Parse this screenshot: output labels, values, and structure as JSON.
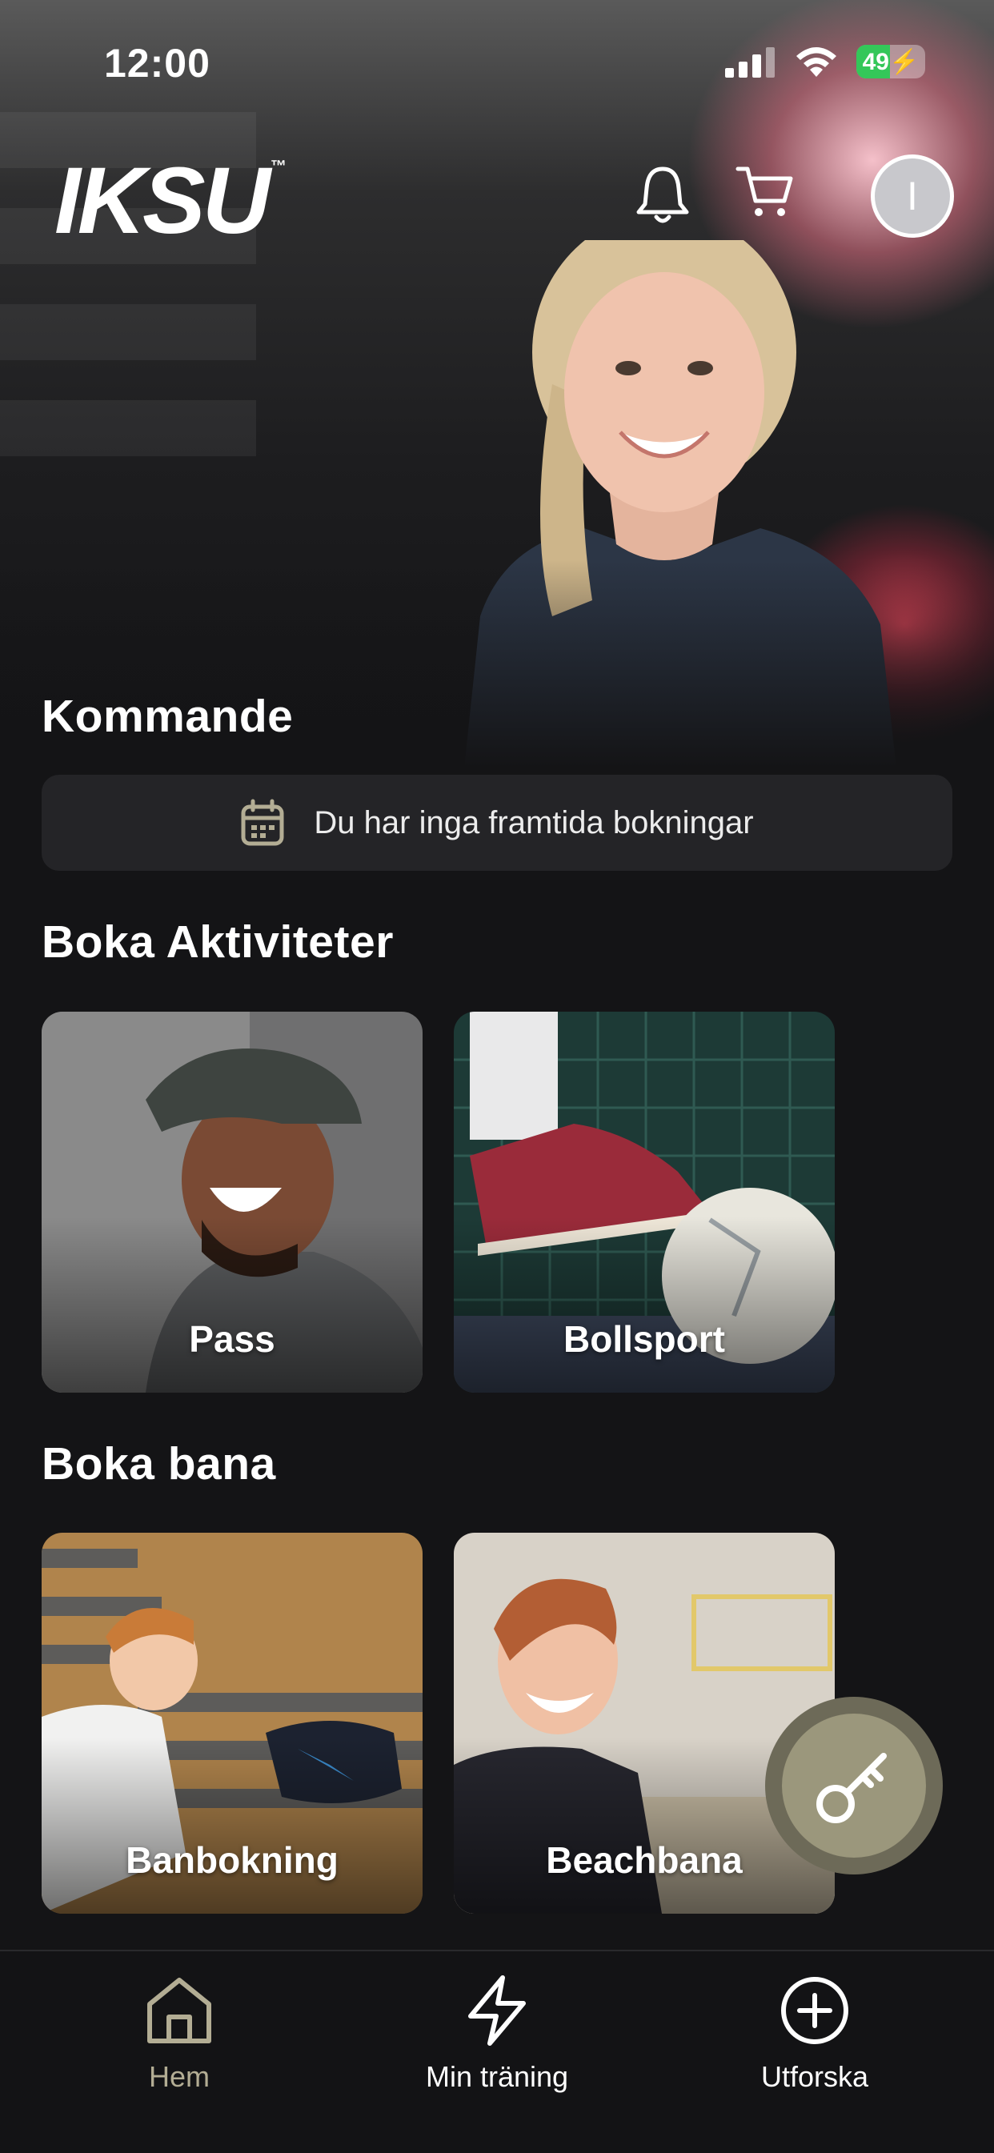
{
  "status_bar": {
    "time": "12:00",
    "battery_level": "49",
    "battery_percent": 49,
    "icons": [
      "cellular-signal-icon",
      "wifi-icon",
      "battery-charging-icon"
    ]
  },
  "header": {
    "logo_text": "IKSU",
    "logo_mark": "™",
    "avatar_initial": "I",
    "icons": [
      "bell-icon",
      "cart-icon"
    ]
  },
  "upcoming": {
    "title": "Kommande",
    "empty_message": "Du har inga framtida bokningar",
    "icon": "calendar-icon"
  },
  "activities": {
    "title": "Boka Aktiviteter",
    "tiles": [
      {
        "label": "Pass"
      },
      {
        "label": "Bollsport"
      }
    ]
  },
  "courts": {
    "title": "Boka bana",
    "tiles": [
      {
        "label": "Banbokning"
      },
      {
        "label": "Beachbana"
      }
    ]
  },
  "fab": {
    "icon": "key-icon"
  },
  "tab_bar": {
    "tabs": [
      {
        "label": "Hem",
        "icon": "home-icon",
        "active": true
      },
      {
        "label": "Min träning",
        "icon": "lightning-icon",
        "active": false
      },
      {
        "label": "Utforska",
        "icon": "plus-circle-icon",
        "active": false
      }
    ]
  },
  "colors": {
    "background": "#141416",
    "card": "#242427",
    "accent": "#b3ad94",
    "fab": "#9b977c",
    "battery": "#34c759"
  }
}
